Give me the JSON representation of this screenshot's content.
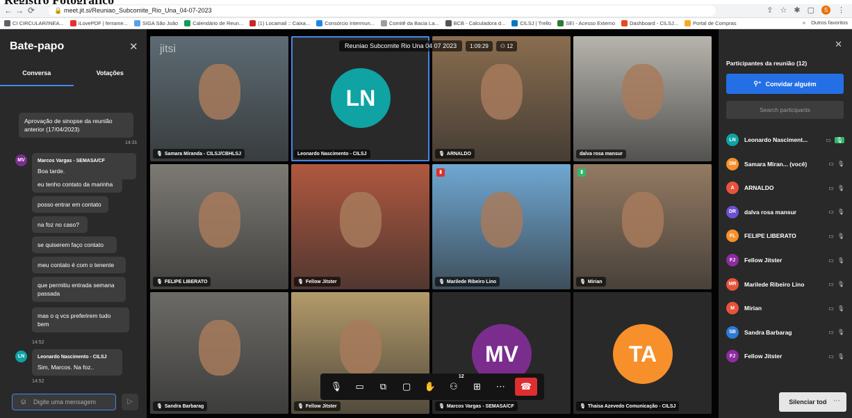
{
  "caption": "Registro Fotográfico",
  "browser": {
    "url": "meet.jit.si/Reuniao_Subcomite_Rio_Una_04-07-2023",
    "profile_initial": "S",
    "bookmarks": [
      {
        "label": "CI CIRCULAR/INEA...",
        "color": "#5f6368"
      },
      {
        "label": "iLovePDF | ferrame...",
        "color": "#e5322d"
      },
      {
        "label": "SIGA São João",
        "color": "#5aa2e8"
      },
      {
        "label": "Calendário de Reun...",
        "color": "#0f9d58"
      },
      {
        "label": "(1) Locamail :: Caixa...",
        "color": "#c62828"
      },
      {
        "label": "Consórcio Intermun...",
        "color": "#1e88e5"
      },
      {
        "label": "Comitê da Bacia La...",
        "color": "#9e9e9e"
      },
      {
        "label": "BCB - Calculadora d...",
        "color": "#555555"
      },
      {
        "label": "CILSJ | Trello",
        "color": "#0079bf"
      },
      {
        "label": "SEI - Acesso Externo",
        "color": "#2e7d32"
      },
      {
        "label": "Dashboard - CILSJ...",
        "color": "#e64a19"
      },
      {
        "label": "Portal de Compras",
        "color": "#f9a825"
      }
    ],
    "bookmarks_more": "»",
    "other_bookmarks": "Outros favoritos"
  },
  "chat": {
    "title": "Bate-papo",
    "tabs": [
      "Conversa",
      "Votações"
    ],
    "messages": [
      {
        "text": "Aprovação de sinopse da reunião anterior (17/04/2023)",
        "time": "14:31"
      },
      {
        "sender": "Marcos Vargas - SEMASA/CF",
        "initials": "MV",
        "text": "Boa tarde."
      },
      {
        "text": "eu tenho contato da marinha"
      },
      {
        "text": "posso entrar em contato"
      },
      {
        "text": "na foz no caso?"
      },
      {
        "text": "se quiserem faço contato"
      },
      {
        "text": "meu contato é com o tenente"
      },
      {
        "text": "que permitiu entrada semana passada"
      },
      {
        "text": "mas o q vcs preferirem tudo bem",
        "time": "14:52"
      },
      {
        "sender": "Leonardo Nascimento - CILSJ",
        "initials": "LN",
        "text": "Sim, Marcos. Na foz..",
        "time": "14:52"
      }
    ],
    "input_placeholder": "Digite uma mensagem"
  },
  "meeting": {
    "title": "Reuniao Subcomite Rio Una 04 07 2023",
    "timer": "1:09:29",
    "count": "12",
    "watermark": "jitsi"
  },
  "tiles": [
    {
      "name": "Samara Miranda - CILSJ/CBHLSJ",
      "bg": "#5d6b73",
      "muted": true
    },
    {
      "name": "Leonardo Nascimento - CILSJ",
      "initials": "LN",
      "avatar_color": "#0fa3a3",
      "active": true
    },
    {
      "name": "ARNALDO",
      "bg": "#8a6d4f",
      "muted": true
    },
    {
      "name": "dalva rosa mansur",
      "bg": "#b7b4ad"
    },
    {
      "name": "FELIPE LIBERATO",
      "bg": "#7d7a74",
      "muted": true
    },
    {
      "name": "Fellow Jitster",
      "bg": "#b0583f",
      "muted": true
    },
    {
      "name": "Marilede Ribeiro Lino",
      "bg": "#6fa8d3",
      "muted": true,
      "signal": "red"
    },
    {
      "name": "Mirian",
      "bg": "#937a62",
      "muted": true,
      "signal": "green"
    },
    {
      "name": "Sandra Barbarag",
      "bg": "#6b6a66",
      "muted": true
    },
    {
      "name": "Fellow Jitster",
      "bg": "#b39a6a",
      "muted": true
    },
    {
      "name": "Marcos Vargas - SEMASA/CF",
      "initials": "MV",
      "avatar_color": "#7b2d8e",
      "muted": true
    },
    {
      "name": "Thaisa Azevedo Comunicação - CILSJ",
      "initials": "TA",
      "avatar_color": "#f7902a",
      "muted": true
    }
  ],
  "toolbar": {
    "participants_badge": "12"
  },
  "participants": {
    "title": "Participantes da reunião (12)",
    "invite_label": "Convidar alguém",
    "search_placeholder": "Search participants",
    "list": [
      {
        "initials": "LN",
        "name": "Leonardo Nasciment...",
        "color": "#0fa3a3",
        "speaking": true
      },
      {
        "initials": "SM",
        "name": "Samara Miran... (você)",
        "color": "#f7902a"
      },
      {
        "initials": "A",
        "name": "ARNALDO",
        "color": "#e8533c"
      },
      {
        "initials": "DR",
        "name": "dalva rosa mansur",
        "color": "#6e4fd1"
      },
      {
        "initials": "FL",
        "name": "FELIPE LIBERATO",
        "color": "#f7902a"
      },
      {
        "initials": "FJ",
        "name": "Fellow Jitster",
        "color": "#8e2c9f"
      },
      {
        "initials": "MR",
        "name": "Marilede Ribeiro Lino",
        "color": "#e8533c"
      },
      {
        "initials": "M",
        "name": "Mirian",
        "color": "#e8533c"
      },
      {
        "initials": "SB",
        "name": "Sandra Barbarag",
        "color": "#2d7ad6"
      },
      {
        "initials": "FJ",
        "name": "Fellow Jitster",
        "color": "#8e2c9f"
      }
    ],
    "mute_all_label": "Silenciar todos"
  }
}
